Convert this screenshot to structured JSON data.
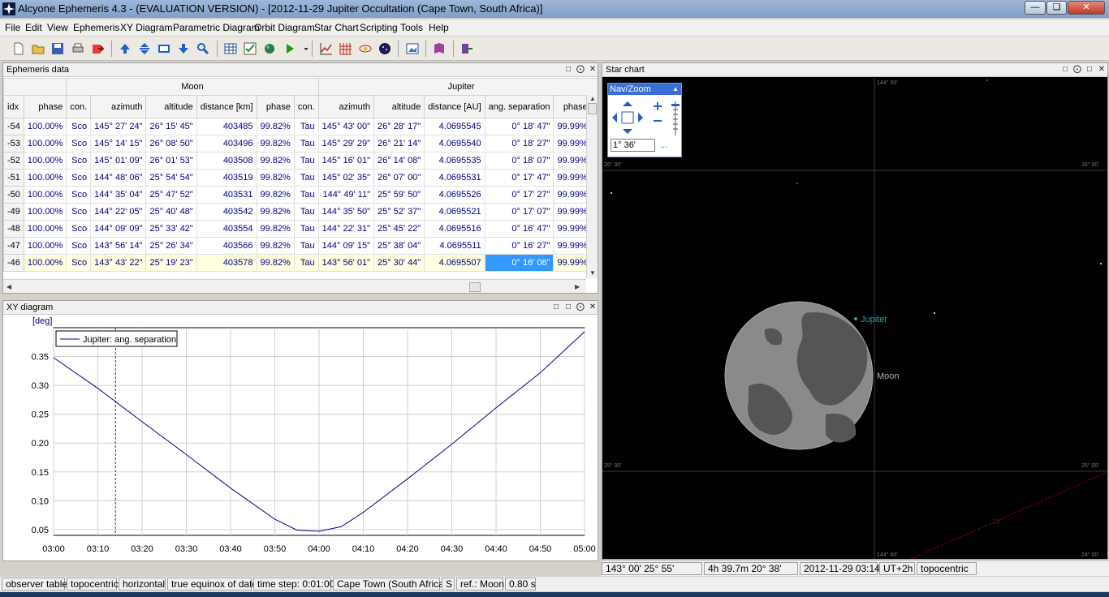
{
  "window": {
    "title": "Alcyone Ephemeris 4.3 - (EVALUATION VERSION) - [2012-11-29 Jupiter Occultation (Cape Town, South Africa)]"
  },
  "menu": [
    "File",
    "Edit",
    "View",
    "Ephemeris",
    "XY Diagram",
    "Parametric Diagram",
    "Orbit Diagram",
    "Star Chart",
    "Scripting",
    "Tools",
    "Help"
  ],
  "ephemeris": {
    "title": "Ephemeris data",
    "group_moon": "Moon",
    "group_jupiter": "Jupiter",
    "headers": [
      "idx",
      "phase",
      "con.",
      "azimuth",
      "altitude",
      "distance [km]",
      "phase",
      "con.",
      "azimuth",
      "altitude",
      "distance [AU]",
      "ang. separation",
      "phase",
      "c"
    ],
    "rows": [
      [
        "-54",
        "100.00%",
        "Sco",
        "145° 27' 24\"",
        "26° 15' 45\"",
        "403485",
        "99.82%",
        "Tau",
        "145° 43' 00\"",
        "26° 28' 17\"",
        "4.0695545",
        "0° 18' 47\"",
        "99.99%",
        "T"
      ],
      [
        "-53",
        "100.00%",
        "Sco",
        "145° 14' 15\"",
        "26° 08' 50\"",
        "403496",
        "99.82%",
        "Tau",
        "145° 29' 29\"",
        "26° 21' 14\"",
        "4.0695540",
        "0° 18' 27\"",
        "99.99%",
        "T"
      ],
      [
        "-52",
        "100.00%",
        "Sco",
        "145° 01' 09\"",
        "26° 01' 53\"",
        "403508",
        "99.82%",
        "Tau",
        "145° 16' 01\"",
        "26° 14' 08\"",
        "4.0695535",
        "0° 18' 07\"",
        "99.99%",
        "T"
      ],
      [
        "-51",
        "100.00%",
        "Sco",
        "144° 48' 06\"",
        "25° 54' 54\"",
        "403519",
        "99.82%",
        "Tau",
        "145° 02' 35\"",
        "26° 07' 00\"",
        "4.0695531",
        "0° 17' 47\"",
        "99.99%",
        "T"
      ],
      [
        "-50",
        "100.00%",
        "Sco",
        "144° 35' 04\"",
        "25° 47' 52\"",
        "403531",
        "99.82%",
        "Tau",
        "144° 49' 11\"",
        "25° 59' 50\"",
        "4.0695526",
        "0° 17' 27\"",
        "99.99%",
        "T"
      ],
      [
        "-49",
        "100.00%",
        "Sco",
        "144° 22' 05\"",
        "25° 40' 48\"",
        "403542",
        "99.82%",
        "Tau",
        "144° 35' 50\"",
        "25° 52' 37\"",
        "4.0695521",
        "0° 17' 07\"",
        "99.99%",
        "T"
      ],
      [
        "-48",
        "100.00%",
        "Sco",
        "144° 09' 09\"",
        "25° 33' 42\"",
        "403554",
        "99.82%",
        "Tau",
        "144° 22' 31\"",
        "25° 45' 22\"",
        "4.0695516",
        "0° 16' 47\"",
        "99.99%",
        "T"
      ],
      [
        "-47",
        "100.00%",
        "Sco",
        "143° 56' 14\"",
        "25° 26' 34\"",
        "403566",
        "99.82%",
        "Tau",
        "144° 09' 15\"",
        "25° 38' 04\"",
        "4.0695511",
        "0° 16' 27\"",
        "99.99%",
        "T"
      ],
      [
        "-46",
        "100.00%",
        "Sco",
        "143° 43' 22\"",
        "25° 19' 23\"",
        "403578",
        "99.82%",
        "Tau",
        "143° 56' 01\"",
        "25° 30' 44\"",
        "4.0695507",
        "0° 16' 06\"",
        "99.99%",
        "T"
      ]
    ]
  },
  "xy": {
    "title": "XY diagram",
    "unit": "[deg]",
    "legend": "Jupiter: ang. separation"
  },
  "chart_data": {
    "type": "line",
    "ylabel": "[deg]",
    "x": [
      "03:00",
      "03:10",
      "03:20",
      "03:30",
      "03:40",
      "03:50",
      "04:00",
      "04:10",
      "04:20",
      "04:30",
      "04:40",
      "04:50",
      "05:00"
    ],
    "x_minutes": [
      0,
      10,
      20,
      30,
      40,
      50,
      60,
      70,
      80,
      90,
      100,
      110,
      120
    ],
    "series": [
      {
        "name": "Jupiter: ang. separation",
        "x_minutes": [
          0,
          10,
          20,
          30,
          40,
          50,
          55,
          60,
          65,
          70,
          80,
          90,
          100,
          110,
          120
        ],
        "values": [
          0.348,
          0.295,
          0.237,
          0.18,
          0.122,
          0.068,
          0.049,
          0.047,
          0.055,
          0.08,
          0.138,
          0.198,
          0.261,
          0.322,
          0.393
        ]
      }
    ],
    "yticks": [
      0.05,
      0.1,
      0.15,
      0.2,
      0.25,
      0.3,
      0.35
    ],
    "ylim": [
      0.04,
      0.4
    ],
    "xlim": [
      0,
      120
    ],
    "cursor_x_minutes": 14,
    "grid": true,
    "legend": "top-left"
  },
  "starchart": {
    "title": "Star chart",
    "navzoom_label": "Nav/Zoom",
    "fov": "1° 36'",
    "more": "...",
    "label_jupiter": "Jupiter",
    "label_moon": "Moon",
    "grid_ra_left": "144° 00'",
    "grid_dec_top": "26° 00'",
    "grid_dec_bottom": "25° 00'",
    "grid_dec_bottom2": "24° 00'",
    "ecliptic_mark": "28"
  },
  "status_chart": [
    "143° 00'   25° 55'",
    "4h 39.7m   20° 38'",
    "2012-11-29  03:14",
    "UT+2h",
    "topocentric"
  ],
  "status_bar": [
    "observer table",
    "topocentric",
    "horizontal",
    "true equinox of date",
    "time step: 0:01:00",
    "Cape Town (South Africa)",
    "S",
    "ref.: Moon",
    "0.80 s"
  ]
}
